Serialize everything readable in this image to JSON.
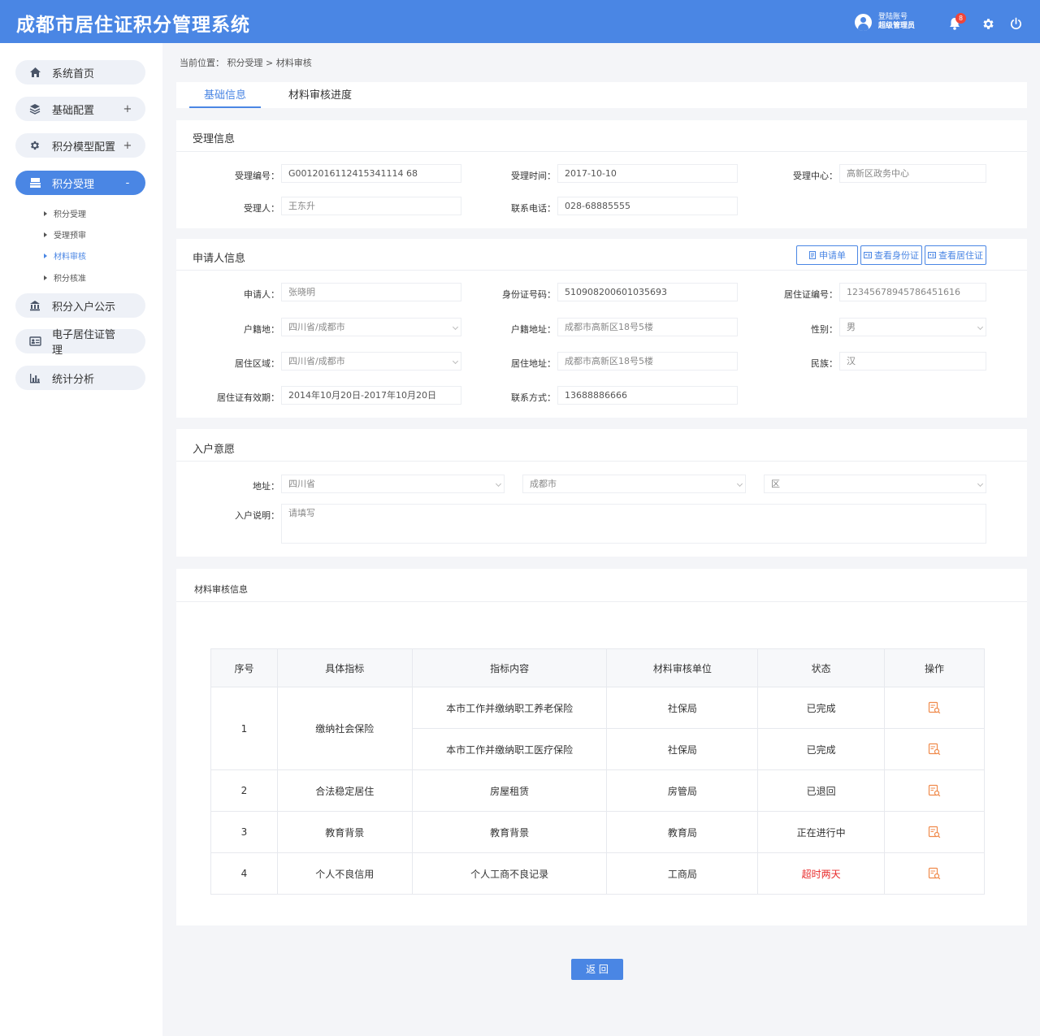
{
  "header": {
    "title": "成都市居住证积分管理系统",
    "account_label": "登陆账号",
    "account_role": "超级管理员",
    "notification_count": "8"
  },
  "sidebar": {
    "items": [
      {
        "label": "系统首页",
        "toggle": ""
      },
      {
        "label": "基础配置",
        "toggle": "+"
      },
      {
        "label": "积分模型配置",
        "toggle": "+"
      },
      {
        "label": "积分受理",
        "toggle": "-"
      },
      {
        "label": "积分入户公示",
        "toggle": ""
      },
      {
        "label": "电子居住证管理",
        "toggle": ""
      },
      {
        "label": "统计分析",
        "toggle": ""
      }
    ],
    "subitems": [
      "积分受理",
      "受理预审",
      "材料审核",
      "积分核准"
    ]
  },
  "breadcrumb": "当前位置： 积分受理 > 材料审核",
  "tabs": [
    "基础信息",
    "材料审核进度"
  ],
  "accept_info": {
    "title": "受理信息",
    "labels": {
      "no": "受理编号：",
      "time": "受理时间：",
      "center": "受理中心：",
      "handler": "受理人：",
      "phone": "联系电话："
    },
    "values": {
      "no": "G0012016112415341114 68",
      "time": "2017-10-10",
      "center": "高新区政务中心",
      "handler": "王东升",
      "phone": "028-68885555"
    }
  },
  "applicant": {
    "title": "申请人信息",
    "buttons": [
      "申请单",
      "查看身份证",
      "查看居住证"
    ],
    "labels": {
      "name": "申请人：",
      "id_no": "身份证号码：",
      "permit_no": "居住证编号：",
      "hukou": "户籍地：",
      "hukou_addr": "户籍地址：",
      "gender": "性别：",
      "area": "居住区域：",
      "address": "居住地址：",
      "ethnicity": "民族：",
      "valid": "居住证有效期：",
      "contact": "联系方式："
    },
    "values": {
      "name": "张晓明",
      "id_no": "510908200601035693",
      "permit_no": "12345678945786451616",
      "hukou": "四川省/成都市",
      "hukou_addr": "成都市高新区18号5楼",
      "gender": "男",
      "area": "四川省/成都市",
      "address": "成都市高新区18号5楼",
      "ethnicity": "汉",
      "valid": "2014年10月20日-2017年10月20日",
      "contact": "13688886666"
    }
  },
  "settle": {
    "title": "入户意愿",
    "address_label": "地址：",
    "province": "四川省",
    "city": "成都市",
    "district": "区",
    "desc_label": "入户说明：",
    "desc_placeholder": "请填写"
  },
  "review": {
    "title": "材料审核信息",
    "headers": [
      "序号",
      "具体指标",
      "指标内容",
      "材料审核单位",
      "状态",
      "操作"
    ],
    "rows": [
      {
        "no": "1",
        "indicator": "缴纳社会保险",
        "content": "本市工作并缴纳职工养老保险",
        "unit": "社保局",
        "status": "已完成"
      },
      {
        "no": "",
        "indicator": "",
        "content": "本市工作并缴纳职工医疗保险",
        "unit": "社保局",
        "status": "已完成"
      },
      {
        "no": "2",
        "indicator": "合法稳定居住",
        "content": "房屋租赁",
        "unit": "房管局",
        "status": "已退回"
      },
      {
        "no": "3",
        "indicator": "教育背景",
        "content": "教育背景",
        "unit": "教育局",
        "status": "正在进行中"
      },
      {
        "no": "4",
        "indicator": "个人不良信用",
        "content": "个人工商不良记录",
        "unit": "工商局",
        "status": "超时两天"
      }
    ]
  },
  "back_label": "返 回",
  "colors": {
    "primary": "#4a86e4",
    "danger": "#e82b2b",
    "badge": "#f0453a",
    "op_icon": "#f08a4b"
  }
}
